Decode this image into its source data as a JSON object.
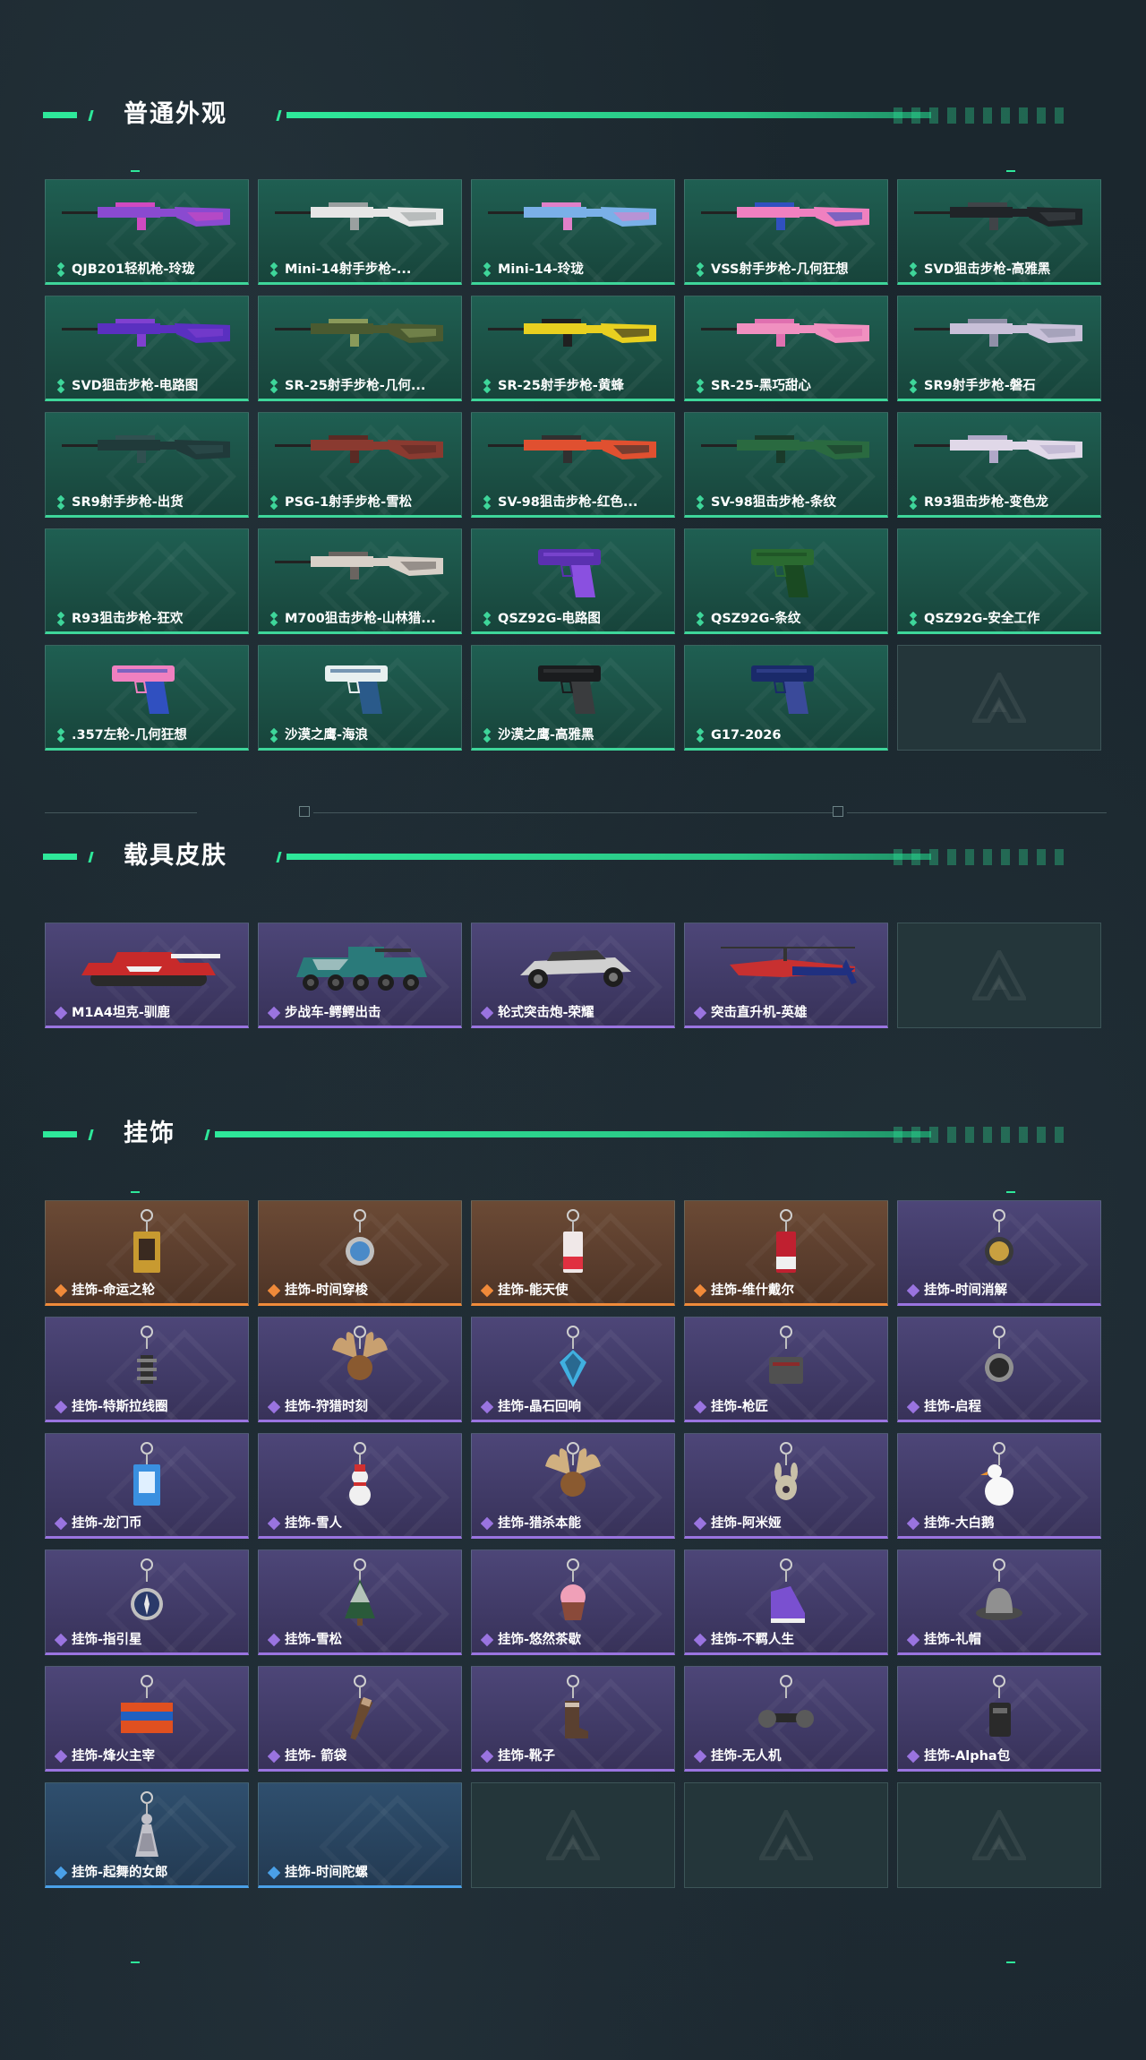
{
  "sections": {
    "weapons": {
      "title": "普通外观"
    },
    "vehicles": {
      "title": "载具皮肤"
    },
    "charms": {
      "title": "挂饰"
    }
  },
  "colors": {
    "accent": "#2ee89a",
    "rarity_green": "#3ed69a",
    "rarity_purple": "#9a74e0",
    "rarity_orange": "#f08a3a",
    "rarity_blue": "#4aa0e8"
  },
  "weapons": [
    {
      "label": "QJB201轻机枪-玲珑",
      "rarity": "green",
      "kind": "rifle",
      "colors": [
        "#8a4ad0",
        "#d04ac0"
      ]
    },
    {
      "label": "Mini-14射手步枪-...",
      "rarity": "green",
      "kind": "rifle",
      "colors": [
        "#e6e6e6",
        "#9aa0a0"
      ]
    },
    {
      "label": "Mini-14-玲珑",
      "rarity": "green",
      "kind": "rifle",
      "colors": [
        "#7ab0e8",
        "#e080c8"
      ]
    },
    {
      "label": "VSS射手步枪-几何狂想",
      "rarity": "green",
      "kind": "rifle",
      "colors": [
        "#f080c0",
        "#3050c0"
      ]
    },
    {
      "label": "SVD狙击步枪-高雅黑",
      "rarity": "green",
      "kind": "rifle",
      "colors": [
        "#202428",
        "#404448"
      ]
    },
    {
      "label": "SVD狙击步枪-电路图",
      "rarity": "green",
      "kind": "rifle",
      "colors": [
        "#5a30c0",
        "#8040d0"
      ]
    },
    {
      "label": "SR-25射手步枪-几何...",
      "rarity": "green",
      "kind": "rifle",
      "colors": [
        "#4a5a30",
        "#8a9a5a"
      ]
    },
    {
      "label": "SR-25射手步枪-黄蜂",
      "rarity": "green",
      "kind": "rifle",
      "colors": [
        "#e8d020",
        "#202020"
      ]
    },
    {
      "label": "SR-25-黑巧甜心",
      "rarity": "green",
      "kind": "rifle",
      "colors": [
        "#f090c0",
        "#e070b0"
      ]
    },
    {
      "label": "SR9射手步枪-磐石",
      "rarity": "green",
      "kind": "rifle",
      "colors": [
        "#c8c0d8",
        "#9090a8"
      ]
    },
    {
      "label": "SR9射手步枪-出货",
      "rarity": "green",
      "kind": "rifle",
      "colors": [
        "#203a3a",
        "#305050"
      ]
    },
    {
      "label": "PSG-1射手步枪-雪松",
      "rarity": "green",
      "kind": "rifle",
      "colors": [
        "#8a3a30",
        "#5a2a24"
      ]
    },
    {
      "label": "SV-98狙击步枪-红色...",
      "rarity": "green",
      "kind": "rifle",
      "colors": [
        "#e05030",
        "#303030"
      ]
    },
    {
      "label": "SV-98狙击步枪-条纹",
      "rarity": "green",
      "kind": "rifle",
      "colors": [
        "#2a6a40",
        "#1a3a2a"
      ]
    },
    {
      "label": "R93狙击步枪-变色龙",
      "rarity": "green",
      "kind": "rifle",
      "colors": [
        "#e0d8e8",
        "#b0a8c8"
      ]
    },
    {
      "label": "R93狙击步枪-狂欢",
      "rarity": "green",
      "kind": "none",
      "colors": []
    },
    {
      "label": "M700狙击步枪-山林猎...",
      "rarity": "green",
      "kind": "rifle",
      "colors": [
        "#d8d0c8",
        "#6a6460"
      ]
    },
    {
      "label": "QSZ92G-电路图",
      "rarity": "green",
      "kind": "pistol",
      "colors": [
        "#5a30b0",
        "#8a50e0"
      ]
    },
    {
      "label": "QSZ92G-条纹",
      "rarity": "green",
      "kind": "pistol",
      "colors": [
        "#2a6a30",
        "#1a4a22"
      ]
    },
    {
      "label": "QSZ92G-安全工作",
      "rarity": "green",
      "kind": "none",
      "colors": []
    },
    {
      "label": ".357左轮-几何狂想",
      "rarity": "green",
      "kind": "revolver",
      "colors": [
        "#f080c0",
        "#3050c0"
      ]
    },
    {
      "label": "沙漠之鹰-海浪",
      "rarity": "green",
      "kind": "pistol",
      "colors": [
        "#e8f0f0",
        "#2a5a8a"
      ]
    },
    {
      "label": "沙漠之鹰-高雅黑",
      "rarity": "green",
      "kind": "pistol",
      "colors": [
        "#1a1c1e",
        "#3a3c3e"
      ]
    },
    {
      "label": "G17-2026",
      "rarity": "green",
      "kind": "pistol",
      "colors": [
        "#1a2a6a",
        "#3a4a9a"
      ]
    }
  ],
  "vehicles": [
    {
      "label": "M1A4坦克-驯鹿",
      "rarity": "purple",
      "kind": "tank",
      "colors": [
        "#c82a2a",
        "#f0f0f0"
      ]
    },
    {
      "label": "步战车-鳄鳄出击",
      "rarity": "purple",
      "kind": "apc",
      "colors": [
        "#2a7a7a",
        "#e8e8e8"
      ]
    },
    {
      "label": "轮式突击炮-荣耀",
      "rarity": "purple",
      "kind": "buggy",
      "colors": [
        "#d0d0d0",
        "#3a3a3a"
      ]
    },
    {
      "label": "突击直升机-英雄",
      "rarity": "purple",
      "kind": "heli",
      "colors": [
        "#c83030",
        "#203080"
      ]
    }
  ],
  "charms": [
    {
      "label": "挂饰-命运之轮",
      "rarity": "orange",
      "kind": "card",
      "colors": [
        "#c89a30",
        "#3a2a20"
      ]
    },
    {
      "label": "挂饰-时间穿梭",
      "rarity": "orange",
      "kind": "ring",
      "colors": [
        "#4a8ac8",
        "#c0c0c0"
      ]
    },
    {
      "label": "挂饰-能天使",
      "rarity": "orange",
      "kind": "tag",
      "colors": [
        "#f0e8e8",
        "#e03040"
      ]
    },
    {
      "label": "挂饰-维什戴尔",
      "rarity": "orange",
      "kind": "tag",
      "colors": [
        "#c02030",
        "#f0f0f0"
      ]
    },
    {
      "label": "挂饰-时间消解",
      "rarity": "purple",
      "kind": "ring",
      "colors": [
        "#c8a040",
        "#3a3a3a"
      ]
    },
    {
      "label": "挂饰-特斯拉线圈",
      "rarity": "purple",
      "kind": "coil",
      "colors": [
        "#303030",
        "#808080"
      ]
    },
    {
      "label": "挂饰-狩猎时刻",
      "rarity": "purple",
      "kind": "antlers",
      "colors": [
        "#c8a070",
        "#8a5a30"
      ]
    },
    {
      "label": "挂饰-晶石回响",
      "rarity": "purple",
      "kind": "gem",
      "colors": [
        "#40b0e0",
        "#1a3a5a"
      ]
    },
    {
      "label": "挂饰-枪匠",
      "rarity": "purple",
      "kind": "box",
      "colors": [
        "#505050",
        "#8a2a2a"
      ]
    },
    {
      "label": "挂饰-启程",
      "rarity": "purple",
      "kind": "ring",
      "colors": [
        "#2a2a2a",
        "#909090"
      ]
    },
    {
      "label": "挂饰-龙门币",
      "rarity": "purple",
      "kind": "card",
      "colors": [
        "#3a90e0",
        "#e0f0ff"
      ]
    },
    {
      "label": "挂饰-雪人",
      "rarity": "purple",
      "kind": "snowman",
      "colors": [
        "#f0f0f0",
        "#d03030"
      ]
    },
    {
      "label": "挂饰-猎杀本能",
      "rarity": "purple",
      "kind": "antlers",
      "colors": [
        "#d0b080",
        "#8a5a30"
      ]
    },
    {
      "label": "挂饰-阿米娅",
      "rarity": "purple",
      "kind": "bunny",
      "colors": [
        "#c8c0a8",
        "#3a3040"
      ]
    },
    {
      "label": "挂饰-大白鹅",
      "rarity": "purple",
      "kind": "goose",
      "colors": [
        "#f8f8f8",
        "#e89030"
      ]
    },
    {
      "label": "挂饰-指引星",
      "rarity": "purple",
      "kind": "compass",
      "colors": [
        "#2a3a6a",
        "#c0c0c0"
      ]
    },
    {
      "label": "挂饰-雪松",
      "rarity": "purple",
      "kind": "tree",
      "colors": [
        "#2a5a3a",
        "#f0f0f0"
      ]
    },
    {
      "label": "挂饰-悠然茶歇",
      "rarity": "purple",
      "kind": "cupcake",
      "colors": [
        "#f0a0b8",
        "#8a4a3a"
      ]
    },
    {
      "label": "挂饰-不羁人生",
      "rarity": "purple",
      "kind": "shoe",
      "colors": [
        "#7a50d0",
        "#f0f0f0"
      ]
    },
    {
      "label": "挂饰-礼帽",
      "rarity": "purple",
      "kind": "hat",
      "colors": [
        "#909090",
        "#4a4a4a"
      ]
    },
    {
      "label": "挂饰-烽火主宰",
      "rarity": "purple",
      "kind": "banner",
      "colors": [
        "#e05020",
        "#2060c0"
      ]
    },
    {
      "label": "挂饰- 箭袋",
      "rarity": "purple",
      "kind": "quiver",
      "colors": [
        "#6a4a30",
        "#c0a080"
      ]
    },
    {
      "label": "挂饰-靴子",
      "rarity": "purple",
      "kind": "boot",
      "colors": [
        "#5a4030",
        "#d0c0b0"
      ]
    },
    {
      "label": "挂饰-无人机",
      "rarity": "purple",
      "kind": "drone",
      "colors": [
        "#2a2a2a",
        "#5a5a5a"
      ]
    },
    {
      "label": "挂饰-Alpha包",
      "rarity": "purple",
      "kind": "bag",
      "colors": [
        "#2a2a2a",
        "#6a6a6a"
      ]
    },
    {
      "label": "挂饰-起舞的女郎",
      "rarity": "blue",
      "kind": "figure",
      "colors": [
        "#c0c0c8",
        "#6a6a7a"
      ]
    },
    {
      "label": "挂饰-时间陀螺",
      "rarity": "blue",
      "kind": "none",
      "colors": []
    }
  ]
}
